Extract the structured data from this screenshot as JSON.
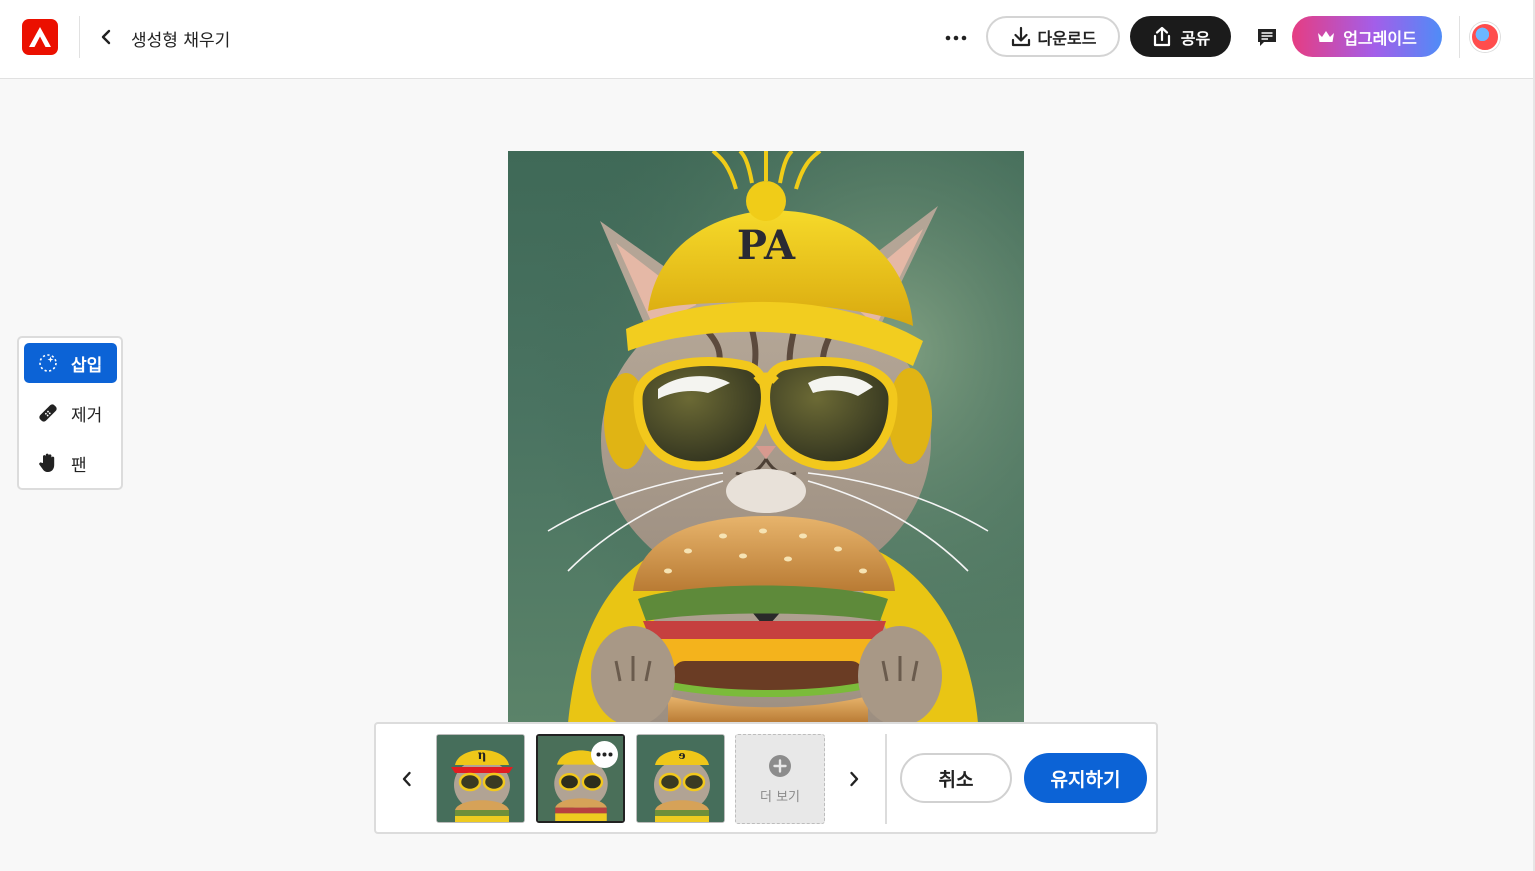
{
  "header": {
    "title": "생성형 채우기",
    "download_label": "다운로드",
    "share_label": "공유",
    "upgrade_label": "업그레이드"
  },
  "tools": {
    "items": [
      {
        "label": "삽입",
        "icon": "sparkle-insert-icon",
        "active": true
      },
      {
        "label": "제거",
        "icon": "eraser-bandage-icon",
        "active": false
      },
      {
        "label": "팬",
        "icon": "hand-icon",
        "active": false
      }
    ]
  },
  "canvas": {
    "hat_text": "PA"
  },
  "variations": {
    "thumb_labels": [
      "η",
      "",
      "ɘ"
    ],
    "selected_index": 1,
    "see_more_label": "더 보기",
    "cancel_label": "취소",
    "keep_label": "유지하기"
  },
  "colors": {
    "accent_blue": "#0c63d6",
    "adobe_red": "#eb1000",
    "share_black": "#1b1b1b",
    "upgrade_gradient_start": "#e63d82",
    "upgrade_gradient_end": "#4f8cf7"
  }
}
